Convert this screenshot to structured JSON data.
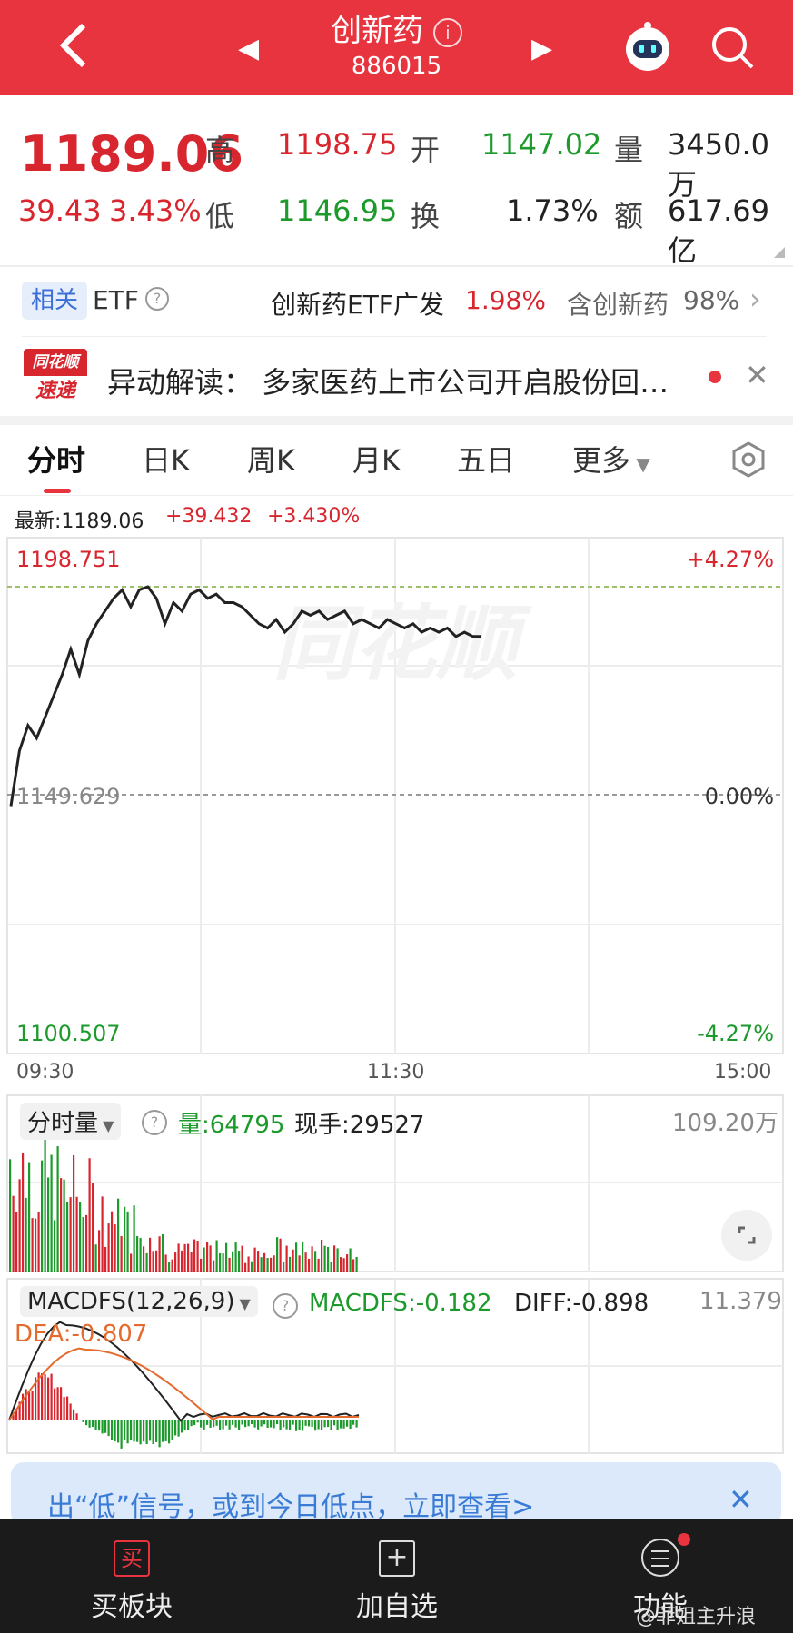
{
  "header": {
    "title": "创新药",
    "code": "886015"
  },
  "quote": {
    "price": "1189.06",
    "change": "39.43",
    "change_pct": "3.43%",
    "high_label": "高",
    "high": "1198.75",
    "open_label": "开",
    "open": "1147.02",
    "volume_label": "量",
    "volume": "3450.0万",
    "low_label": "低",
    "low": "1146.95",
    "turnover_label": "换",
    "turnover": "1.73%",
    "amount_label": "额",
    "amount": "617.69亿"
  },
  "etf": {
    "tag": "相关",
    "label": "ETF",
    "name": "创新药ETF广发",
    "pct": "1.98%",
    "contain_label": "含创新药",
    "contain_pct": "98%"
  },
  "news": {
    "logo_top": "同花顺",
    "logo_bottom": "速递",
    "text": "异动解读：  多家医药上市公司开启股份回…"
  },
  "tabs": [
    "分时",
    "日K",
    "周K",
    "月K",
    "五日",
    "更多"
  ],
  "chart": {
    "latest_label": "最新:1189.06",
    "latest_change": "+39.432",
    "latest_pct": "+3.430%",
    "y_top": "1198.751",
    "y_mid": "1149.629",
    "y_bot": "1100.507",
    "pct_top": "+4.27%",
    "pct_mid": "0.00%",
    "pct_bot": "-4.27%",
    "watermark": "同花顺",
    "time_start": "09:30",
    "time_mid": "11:30",
    "time_end": "15:00"
  },
  "chart_data": {
    "type": "line",
    "x": [
      0,
      2,
      4,
      6,
      8,
      10,
      12,
      14,
      16,
      18,
      20,
      22,
      24,
      26,
      28,
      30,
      32,
      34,
      36,
      38,
      40,
      42,
      44,
      46,
      48,
      50,
      52,
      54,
      56,
      58,
      60,
      62,
      64,
      66,
      68,
      70,
      72,
      74,
      76,
      78,
      80,
      82,
      84,
      86,
      88,
      90,
      92,
      94,
      96,
      98,
      100,
      102,
      104,
      106,
      108,
      110
    ],
    "y": [
      1146.95,
      1160,
      1166,
      1163,
      1168,
      1173,
      1178,
      1184,
      1178,
      1186,
      1190,
      1193,
      1196,
      1198,
      1194,
      1198,
      1198.75,
      1196,
      1190,
      1195,
      1193,
      1197,
      1198,
      1196,
      1197,
      1195,
      1195,
      1194,
      1192,
      1190,
      1189,
      1191,
      1188,
      1190,
      1193,
      1192,
      1193,
      1191,
      1192,
      1193,
      1190,
      1191,
      1190,
      1189,
      1191,
      1190,
      1189,
      1190,
      1188,
      1189,
      1188,
      1189,
      1187,
      1188,
      1187,
      1187
    ],
    "xlabel": "",
    "ylabel": "",
    "ylim": [
      1100.507,
      1198.751
    ]
  },
  "volume": {
    "label": "分时量",
    "vol": "量:64795",
    "hand": "现手:29527",
    "max": "109.20万"
  },
  "macd": {
    "label": "MACDFS(12,26,9)",
    "value": "MACDFS:-0.182",
    "diff": "DIFF:-0.898",
    "dea": "DEA:-0.807",
    "max": "11.379"
  },
  "banner": {
    "text": "出“低”信号，或到今日低点，立即查看>"
  },
  "bottom": {
    "buy": "买板块",
    "buy_icon": "买",
    "add": "加自选",
    "func": "功能"
  },
  "watermark_weibo": "@菲姐主升浪",
  "colors": {
    "red": "#d8262f",
    "green": "#1d9a2c",
    "header": "#e8343f"
  }
}
